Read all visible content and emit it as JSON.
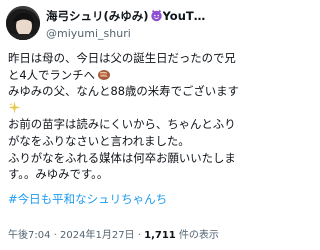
{
  "author": {
    "display_name": "海弓シュリ(みゆみ)",
    "display_name_suffix": "YouT…",
    "handle": "@miyumi_shuri",
    "avatar_icon": "avatar-icon"
  },
  "tweet": {
    "lines": [
      "昨日は母の、今日は父の誕生日だったので兄",
      "と4人でランチへ",
      "みゆみの父、なんと88歳の米寿でございます",
      "",
      "お前の苗字は読みにくいから、ちゃんとふり",
      "がなをふりなさいと言われました。",
      "ふりがなをふれる媒体は何卒お願いいたしま",
      "す。。みゆみです。。"
    ],
    "hashtag": "#今日も平和なシュリちゃんち",
    "emoji_names": [
      "cute-demon-icon",
      "rainbow-icon",
      "meat-icon",
      "sparkle-icon"
    ]
  },
  "meta": {
    "time": "午後7:04",
    "separator": " · ",
    "date": "2024年1月27日",
    "views_count": "1,711",
    "views_label": " 件の表示"
  }
}
